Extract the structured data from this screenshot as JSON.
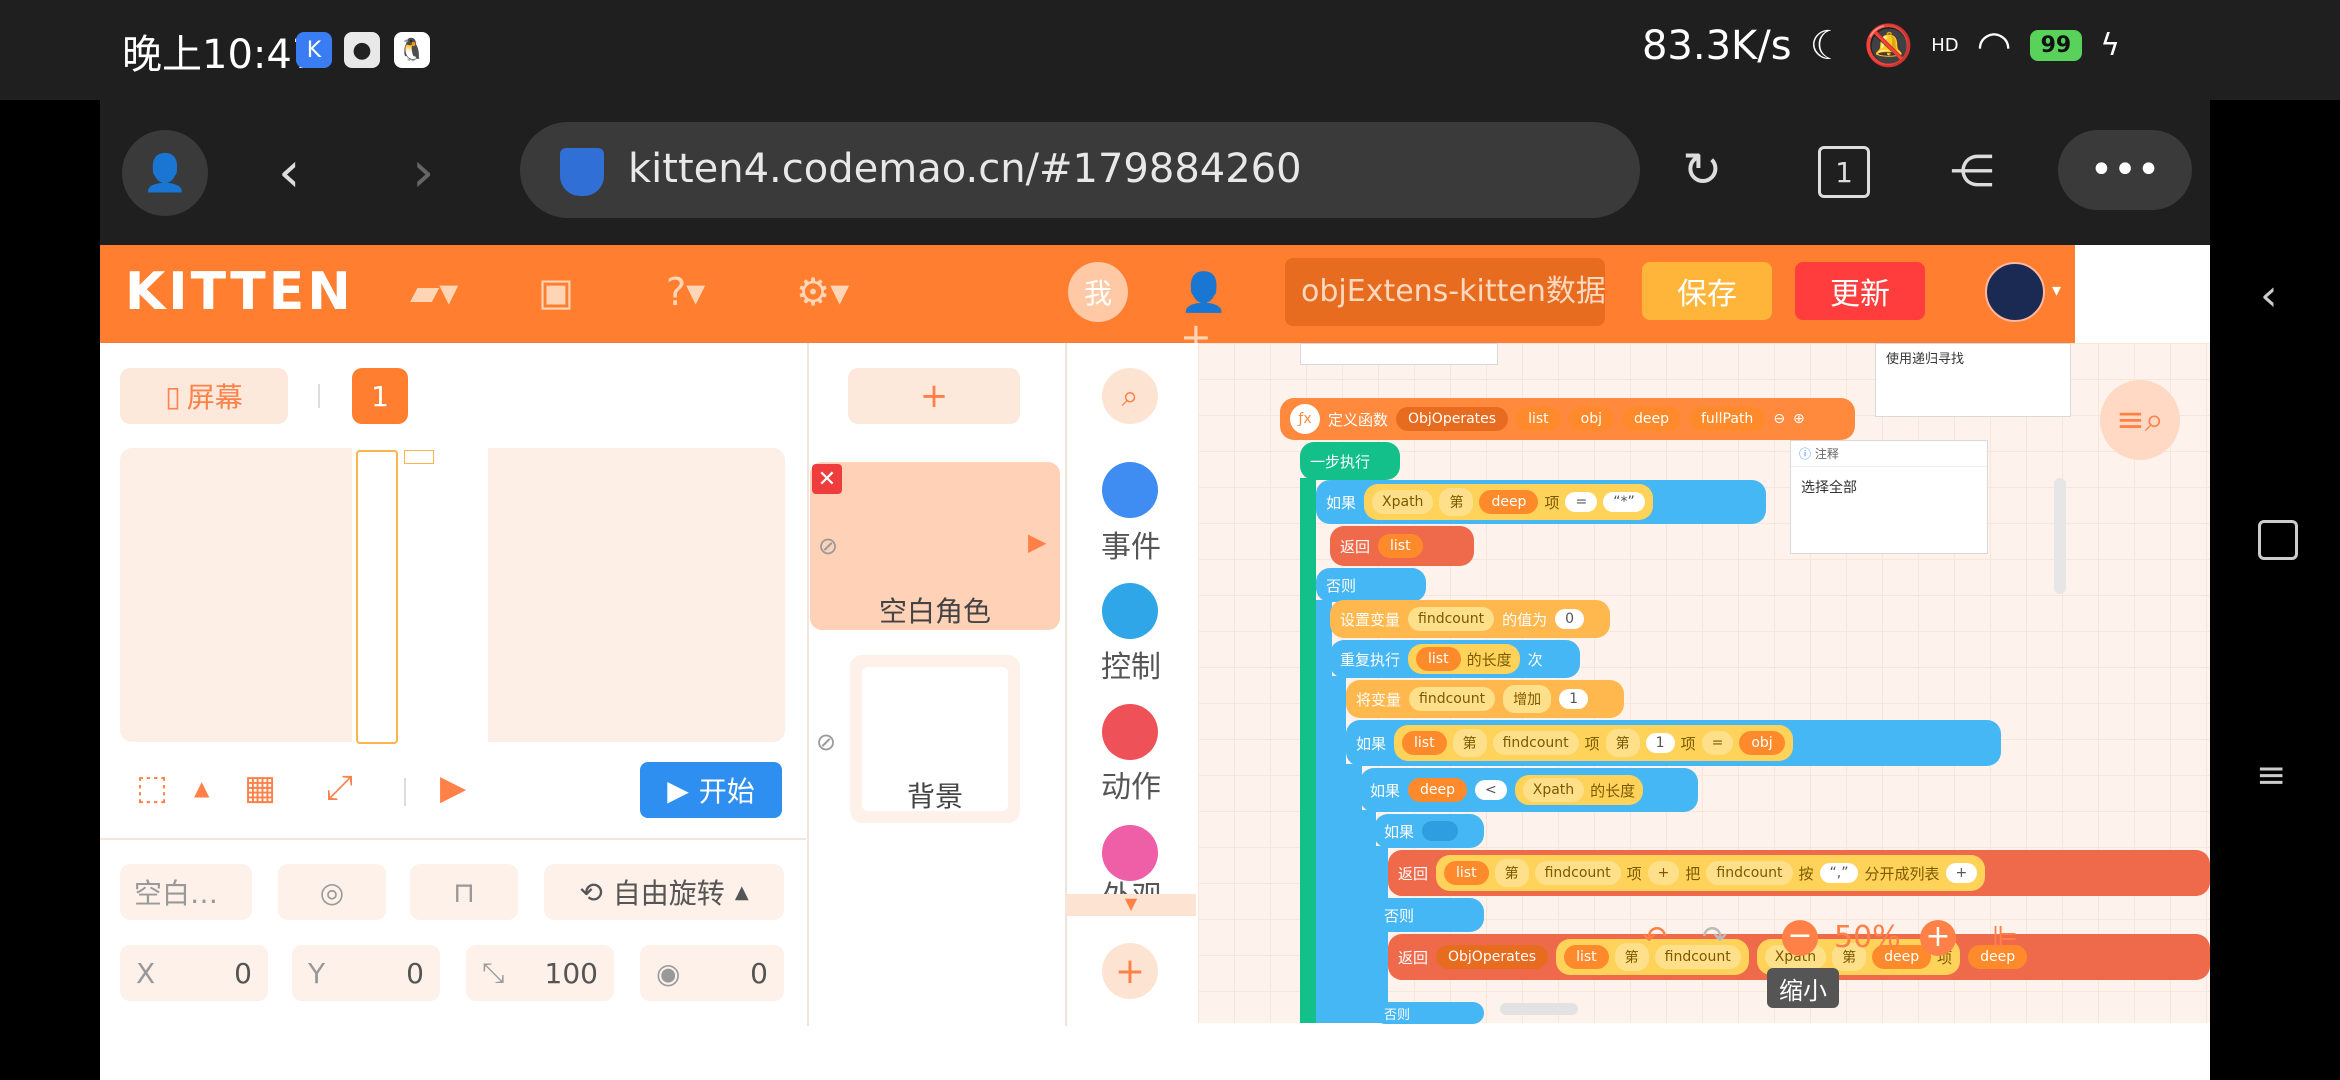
{
  "status_bar": {
    "time": "晚上10:47",
    "network_speed": "83.3K/s",
    "signal_label": "HD",
    "battery": "99"
  },
  "browser": {
    "url": "kitten4.codemao.cn/#179884260",
    "tab_count": "1"
  },
  "header": {
    "logo": "KITTEN",
    "me_label": "我",
    "project_name": "objExtens-kitten数据…",
    "save_label": "保存",
    "update_label": "更新"
  },
  "stage_panel": {
    "screen_label": "屏幕",
    "screen_number": "1",
    "start_label": "开始",
    "sprite_name": "空白…",
    "rotation_label": "自由旋转",
    "x_label": "X",
    "x_value": "0",
    "y_label": "Y",
    "y_value": "0",
    "scale_value": "100",
    "direction_value": "0"
  },
  "roles": {
    "add_label": "+",
    "role_name": "空白角色",
    "background_name": "背景"
  },
  "categories": [
    {
      "label": "事件",
      "color": "#3f8cf2"
    },
    {
      "label": "控制",
      "color": "#2ea6e8"
    },
    {
      "label": "动作",
      "color": "#ee5157"
    },
    {
      "label": "外观",
      "color": "#ef5fa7"
    }
  ],
  "workspace": {
    "comment_top": "使用递归寻找",
    "comment_note_title": "注释",
    "comment_note_body": "选择全部",
    "define_func": "定义函数",
    "func_name": "ObjOperates",
    "params": [
      "list",
      "obj",
      "deep",
      "fullPath"
    ],
    "step_exec": "一步执行",
    "if_label": "如果",
    "return_label": "返回",
    "else_label": "否则",
    "set_var": "设置变量",
    "value_of": "的值为",
    "repeat": "重复执行",
    "length_of": "的长度",
    "times": "次",
    "change_var": "将变量",
    "increase": "增加",
    "xpath": "Xpath",
    "nth": "第",
    "item": "项",
    "eq": "=",
    "lt": "<",
    "deep": "deep",
    "list": "list",
    "obj": "obj",
    "findcount": "findcount",
    "zero": "0",
    "one": "1",
    "star": "“*”",
    "comma": "“,”",
    "plus": "+",
    "split_label": "分开成列表",
    "by": "按",
    "of": "把",
    "zoom": "50%",
    "zoom_tooltip": "缩小"
  }
}
